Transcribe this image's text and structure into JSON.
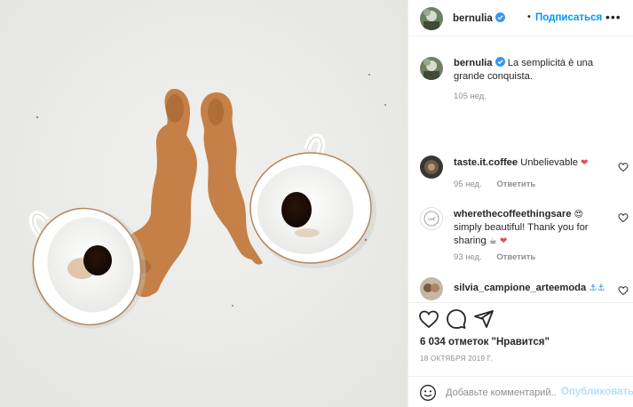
{
  "post": {
    "author": "bernulia",
    "follow_label": "Подписаться",
    "dot": "•",
    "more": "•••"
  },
  "caption": {
    "author": "bernulia",
    "text": "La semplicità è una grande conquista.",
    "time": "105 нед."
  },
  "comments": [
    {
      "author": "taste.it.coffee",
      "text": "Unbelievable",
      "emoji": "❤",
      "time": "95 нед.",
      "reply": "Ответить"
    },
    {
      "author": "wherethecoffeethingsare",
      "text_before": "simply beautiful! Thank you for sharing",
      "emoji1": "😍",
      "emoji2": "☕",
      "emoji3": "❤",
      "time": "93 нед.",
      "reply": "Ответить"
    },
    {
      "author": "silvia_campione_arteemoda",
      "emoji": "⚓⚓"
    }
  ],
  "likes": "6 034 отметок \"Нравится\"",
  "date": "18 ОКТЯБРЯ 2019 Г.",
  "add_comment": {
    "placeholder": "Добавьте комментарий...",
    "post_label": "Опубликовать"
  },
  "colors": {
    "accent": "#0095f6",
    "post_disabled": "#b2dffc",
    "muted": "#8e8e8e",
    "heart": "#ed4956",
    "coffee": "#b8652a"
  },
  "icons": {
    "like": "heart-outline-icon",
    "comment": "comment-bubble-icon",
    "share": "paper-plane-icon",
    "verified": "verified-badge-icon",
    "emoji": "smiley-icon"
  }
}
